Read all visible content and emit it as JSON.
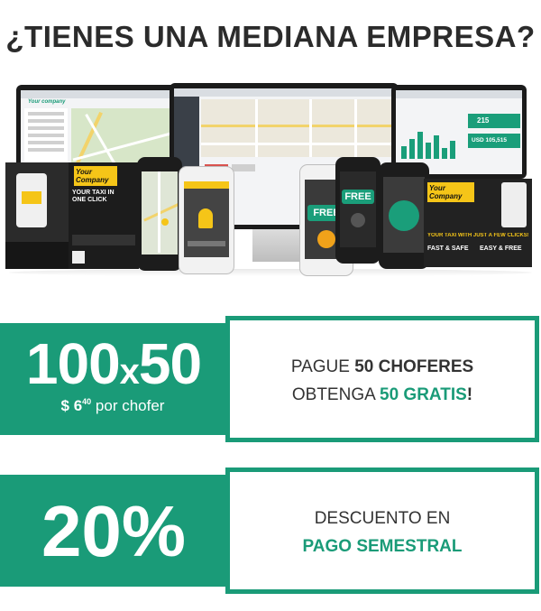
{
  "headline": "¿TIENES UNA MEDIANA EMPRESA?",
  "colors": {
    "brand_green": "#1a9b78",
    "taxi_yellow": "#f5c518",
    "text_dark": "#2b2b2b"
  },
  "montage": {
    "monitor_left_brand": "Your company",
    "monitor_right_stats": [
      "215",
      "USD 105,515"
    ],
    "poster_left": {
      "logo": "Your Company",
      "tagline": "YOUR TAXI IN ONE CLICK"
    },
    "phone_free_label": "FREE",
    "phone_free_label_2": "FREE",
    "poster_right": {
      "logo": "Your Company",
      "tagline": "YOUR TAXI WITH JUST A FEW CLICKS!",
      "badge_1": "FAST & SAFE",
      "badge_2": "EASY & FREE"
    }
  },
  "offer_1": {
    "big": "100",
    "times": "x",
    "big2": "50",
    "price_prefix": "$ 6",
    "price_cents": "40",
    "price_suffix": " por chofer",
    "line1_a": "PAGUE ",
    "line1_b": "50 CHOFERES",
    "line2_a": "OBTENGA ",
    "line2_b": "50 GRATIS",
    "line2_c": "!"
  },
  "offer_2": {
    "big": "20%",
    "line1": "DESCUENTO EN",
    "line2": "PAGO SEMESTRAL"
  }
}
